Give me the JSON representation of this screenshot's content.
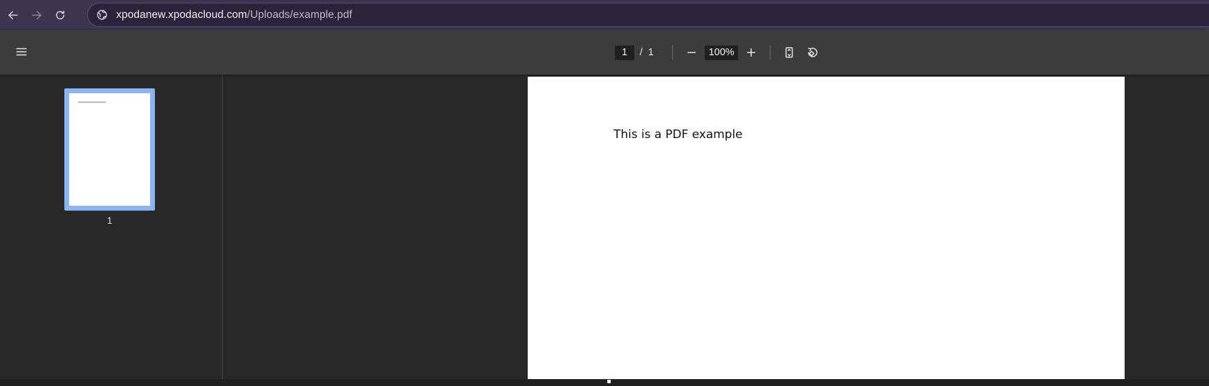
{
  "browser": {
    "url_host": "xpodanew.xpodacloud.com",
    "url_path": "/Uploads/example.pdf",
    "icons": {
      "back": "arrow-left-icon",
      "forward": "arrow-right-icon",
      "reload": "reload-icon",
      "site_info": "globe-icon"
    }
  },
  "toolbar": {
    "current_page": "1",
    "separator": "/",
    "total_pages": "1",
    "zoom": "100%",
    "icons": {
      "menu": "hamburger-menu-icon",
      "zoom_out": "minus-icon",
      "zoom_in": "plus-icon",
      "fit": "fit-to-page-icon",
      "rotate": "rotate-counterclockwise-icon"
    }
  },
  "sidebar": {
    "thumbnails": [
      {
        "label": "1",
        "selected": true
      }
    ]
  },
  "document": {
    "pages": [
      {
        "text": "This is a PDF example"
      }
    ]
  },
  "colors": {
    "browser_bar": "#3c3550",
    "omnibox": "#2a2438",
    "toolbar": "#3c3c3c",
    "background": "#282828",
    "thumbnail_selection": "#8ab4f8"
  }
}
